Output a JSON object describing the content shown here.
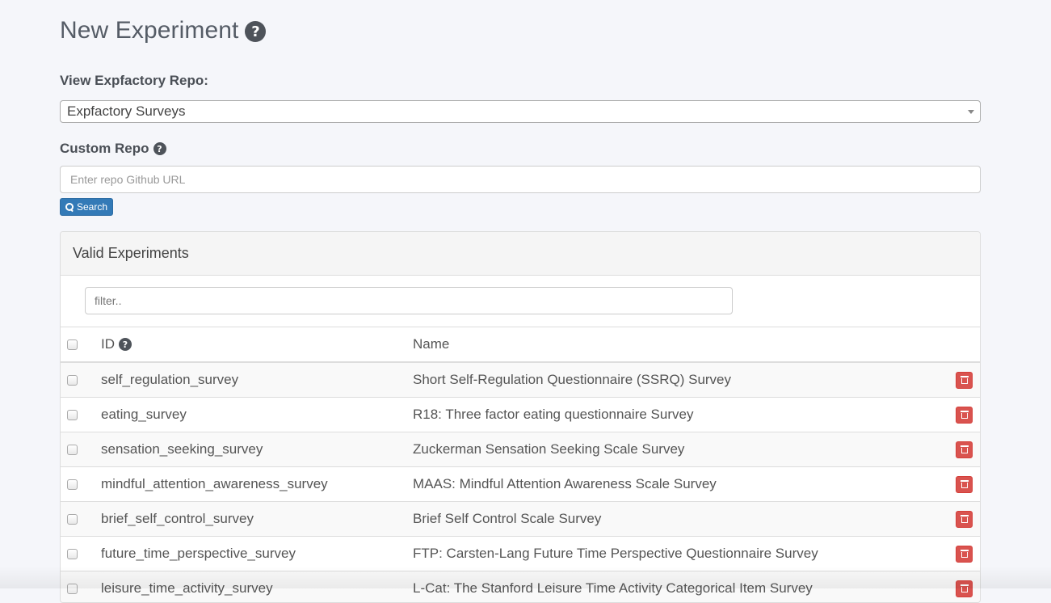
{
  "page": {
    "title": "New Experiment",
    "title_help_icon": "question-circle-icon"
  },
  "repo_select": {
    "label": "View Expfactory Repo:",
    "selected": "Expfactory Surveys"
  },
  "custom_repo": {
    "label": "Custom Repo",
    "help_icon": "question-circle-icon",
    "placeholder": "Enter repo Github URL",
    "value": "",
    "search_button": "Search",
    "search_icon": "search-icon"
  },
  "panel": {
    "heading": "Valid Experiments",
    "filter_placeholder": "filter..",
    "filter_value": "",
    "columns": {
      "id": "ID",
      "name": "Name"
    },
    "delete_icon": "trash-icon",
    "colors": {
      "delete_button": "#d9534f",
      "primary_button": "#337ab7"
    },
    "rows": [
      {
        "id": "self_regulation_survey",
        "name": "Short Self-Regulation Questionnaire (SSRQ) Survey",
        "checked": false
      },
      {
        "id": "eating_survey",
        "name": "R18: Three factor eating questionnaire Survey",
        "checked": false
      },
      {
        "id": "sensation_seeking_survey",
        "name": "Zuckerman Sensation Seeking Scale Survey",
        "checked": false
      },
      {
        "id": "mindful_attention_awareness_survey",
        "name": "MAAS: Mindful Attention Awareness Scale Survey",
        "checked": false
      },
      {
        "id": "brief_self_control_survey",
        "name": "Brief Self Control Scale Survey",
        "checked": false
      },
      {
        "id": "future_time_perspective_survey",
        "name": "FTP: Carsten-Lang Future Time Perspective Questionnaire Survey",
        "checked": false
      },
      {
        "id": "leisure_time_activity_survey",
        "name": "L-Cat: The Stanford Leisure Time Activity Categorical Item Survey",
        "checked": false
      }
    ]
  }
}
